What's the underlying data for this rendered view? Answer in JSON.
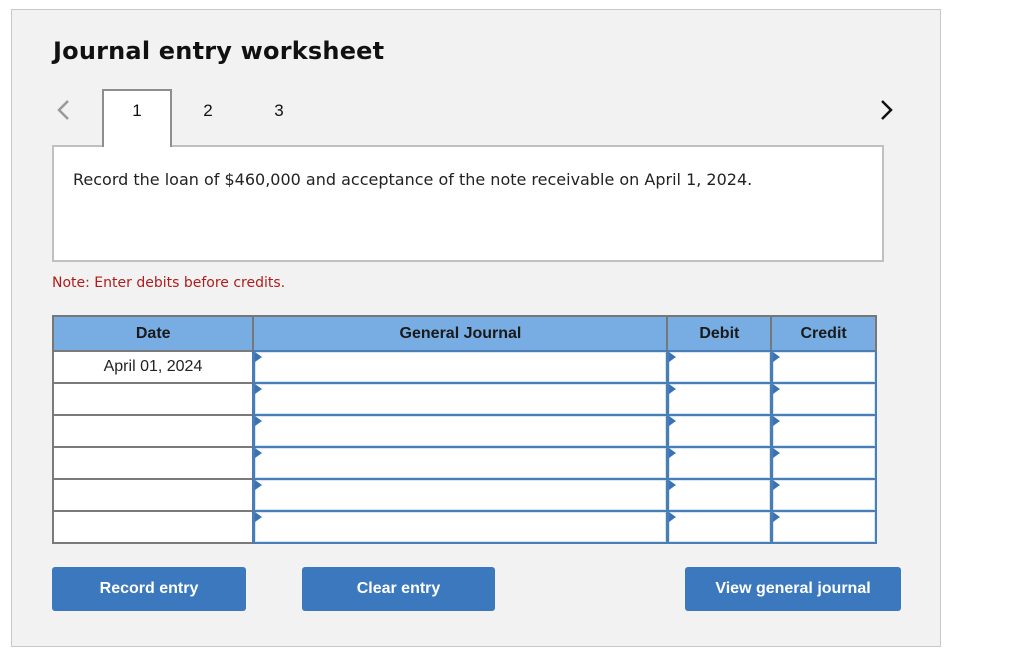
{
  "header": {
    "title": "Journal entry worksheet"
  },
  "navigation": {
    "prev_icon": "chevron-left-icon",
    "next_icon": "chevron-right-icon",
    "tabs": [
      {
        "label": "1",
        "active": true
      },
      {
        "label": "2",
        "active": false
      },
      {
        "label": "3",
        "active": false
      }
    ]
  },
  "instruction": {
    "text": "Record the loan of $460,000 and acceptance of the note receivable on April 1, 2024."
  },
  "note": {
    "text": "Note: Enter debits before credits.",
    "color": "#b01c1c"
  },
  "journal_table": {
    "columns": [
      "Date",
      "General Journal",
      "Debit",
      "Credit"
    ],
    "header_color": "#77ade3",
    "rows": [
      {
        "date": "April 01, 2024",
        "account": "",
        "debit": "",
        "credit": ""
      },
      {
        "date": "",
        "account": "",
        "debit": "",
        "credit": ""
      },
      {
        "date": "",
        "account": "",
        "debit": "",
        "credit": ""
      },
      {
        "date": "",
        "account": "",
        "debit": "",
        "credit": ""
      },
      {
        "date": "",
        "account": "",
        "debit": "",
        "credit": ""
      },
      {
        "date": "",
        "account": "",
        "debit": "",
        "credit": ""
      }
    ]
  },
  "buttons": {
    "record": "Record entry",
    "clear": "Clear entry",
    "view": "View general journal",
    "color": "#3b78bd"
  }
}
